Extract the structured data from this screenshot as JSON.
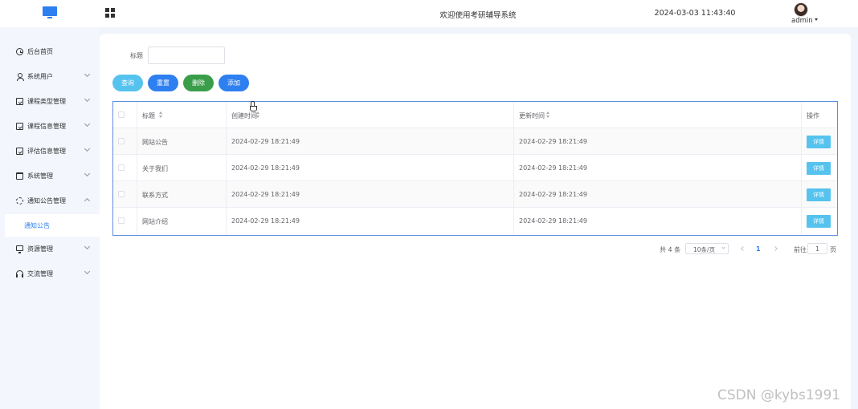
{
  "header": {
    "site_title": "欢迎使用考研辅导系统",
    "datetime": "2024-03-03 11:43:40",
    "username": "admin"
  },
  "sidebar": {
    "items": [
      {
        "label": "后台首页",
        "icon": "clock-icon"
      },
      {
        "label": "系统用户",
        "icon": "user-icon"
      },
      {
        "label": "课程类型管理",
        "icon": "checkbox-icon"
      },
      {
        "label": "课程信息管理",
        "icon": "checkbox-icon"
      },
      {
        "label": "评估信息管理",
        "icon": "checkbox-icon"
      },
      {
        "label": "系统管理",
        "icon": "folder-icon"
      },
      {
        "label": "通知公告管理",
        "icon": "megaphone-icon",
        "expanded": true
      },
      {
        "label": "资源管理",
        "icon": "monitor-icon"
      },
      {
        "label": "交流管理",
        "icon": "headset-icon"
      }
    ],
    "active_subitem": "通知公告"
  },
  "search": {
    "label": "标题",
    "value": "",
    "placeholder": ""
  },
  "toolbar": {
    "query_label": "查询",
    "reset_label": "重置",
    "delete_label": "删除",
    "add_label": "添加"
  },
  "table": {
    "columns": {
      "title": "标题",
      "created": "创建时间",
      "updated": "更新时间",
      "operation": "操作"
    },
    "rows": [
      {
        "title": "网站公告",
        "created": "2024-02-29 18:21:49",
        "updated": "2024-02-29 18:21:49",
        "action": "详情"
      },
      {
        "title": "关于我们",
        "created": "2024-02-29 18:21:49",
        "updated": "2024-02-29 18:21:49",
        "action": "详情"
      },
      {
        "title": "联系方式",
        "created": "2024-02-29 18:21:49",
        "updated": "2024-02-29 18:21:49",
        "action": "详情"
      },
      {
        "title": "网站介绍",
        "created": "2024-02-29 18:21:49",
        "updated": "2024-02-29 18:21:49",
        "action": "详情"
      }
    ]
  },
  "pagination": {
    "total": "共 4 条",
    "page_size": "10条/页",
    "current_page": "1",
    "goto_label": "前往",
    "goto_value": "1",
    "goto_unit": "页"
  },
  "watermark": "CSDN @kybs1991",
  "colors": {
    "primary": "#2e7ff0",
    "info": "#56c3ee",
    "success": "#3a9d4a",
    "sidebar_bg": "#f3f6fc"
  }
}
